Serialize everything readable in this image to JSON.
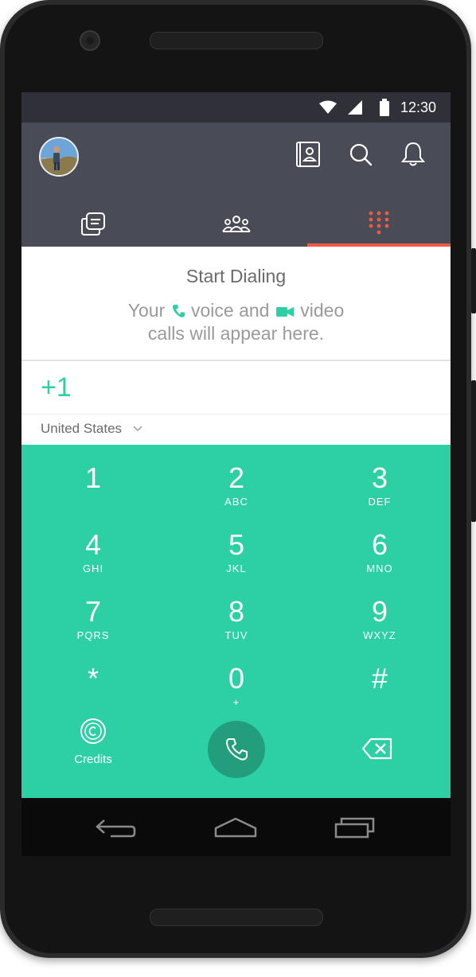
{
  "status_bar": {
    "time": "12:30"
  },
  "header": {
    "icons": [
      "contacts-book-icon",
      "search-icon",
      "bell-icon"
    ],
    "tabs": [
      "chats-tab",
      "groups-tab",
      "dialpad-tab"
    ],
    "active_tab_index": 2
  },
  "empty_state": {
    "title": "Start Dialing",
    "line1_prefix": "Your",
    "line1_voice": "voice and",
    "line1_video": "video",
    "line2": "calls will appear here."
  },
  "dialer": {
    "number": "+1",
    "country": "United States"
  },
  "keypad": {
    "keys": [
      {
        "digit": "1",
        "letters": ""
      },
      {
        "digit": "2",
        "letters": "ABC"
      },
      {
        "digit": "3",
        "letters": "DEF"
      },
      {
        "digit": "4",
        "letters": "GHI"
      },
      {
        "digit": "5",
        "letters": "JKL"
      },
      {
        "digit": "6",
        "letters": "MNO"
      },
      {
        "digit": "7",
        "letters": "PQRS"
      },
      {
        "digit": "8",
        "letters": "TUV"
      },
      {
        "digit": "9",
        "letters": "WXYZ"
      },
      {
        "digit": "*",
        "letters": ""
      },
      {
        "digit": "0",
        "letters": "+"
      },
      {
        "digit": "#",
        "letters": ""
      }
    ],
    "credits_label": "Credits"
  },
  "colors": {
    "accent": "#2dcfa5",
    "tab_indicator": "#ee5a44",
    "header_bg": "#494b57"
  }
}
